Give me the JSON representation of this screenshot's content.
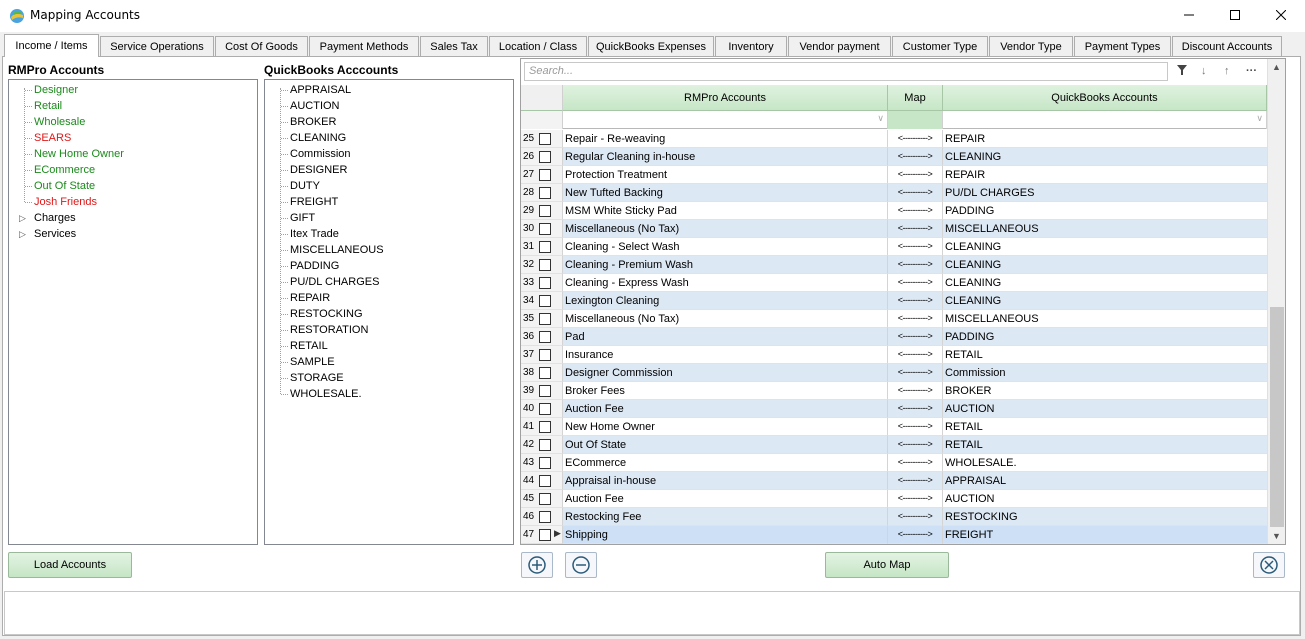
{
  "window": {
    "title": "Mapping Accounts"
  },
  "tabs": [
    "Income / Items",
    "Service Operations",
    "Cost Of Goods",
    "Payment Methods",
    "Sales Tax",
    "Location / Class",
    "QuickBooks Expenses",
    "Inventory",
    "Vendor payment",
    "Customer Type",
    "Vendor Type",
    "Payment Types",
    "Discount Accounts"
  ],
  "left": {
    "title": "RMPro Accounts",
    "items": [
      {
        "label": "Designer",
        "color": "green"
      },
      {
        "label": "Retail",
        "color": "green"
      },
      {
        "label": "Wholesale",
        "color": "green"
      },
      {
        "label": "SEARS",
        "color": "red"
      },
      {
        "label": "New Home Owner",
        "color": "green"
      },
      {
        "label": "ECommerce",
        "color": "green"
      },
      {
        "label": "Out Of State",
        "color": "green"
      },
      {
        "label": "Josh Friends",
        "color": "red"
      },
      {
        "label": "Charges",
        "color": "black",
        "expandable": true
      },
      {
        "label": "Services",
        "color": "black",
        "expandable": true
      }
    ],
    "load_button": "Load Accounts"
  },
  "middle": {
    "title": "QuickBooks Acccounts",
    "items": [
      "APPRAISAL",
      "AUCTION",
      "BROKER",
      "CLEANING",
      "Commission",
      "DESIGNER",
      "DUTY",
      "FREIGHT",
      "GIFT",
      "Itex Trade",
      "MISCELLANEOUS",
      "PADDING",
      "PU/DL CHARGES",
      "REPAIR",
      "RESTOCKING",
      "RESTORATION",
      "RETAIL",
      "SAMPLE",
      "STORAGE",
      "WHOLESALE."
    ]
  },
  "grid": {
    "search_placeholder": "Search...",
    "headers": {
      "rmpro": "RMPro Accounts",
      "map": "Map",
      "qb": "QuickBooks Accounts"
    },
    "map_symbol": "<---------->",
    "rows": [
      {
        "n": "25",
        "rm": "Repair - Re-weaving",
        "qb": "REPAIR"
      },
      {
        "n": "26",
        "rm": "Regular Cleaning in-house",
        "qb": "CLEANING"
      },
      {
        "n": "27",
        "rm": "Protection Treatment",
        "qb": "REPAIR"
      },
      {
        "n": "28",
        "rm": "New Tufted Backing",
        "qb": "PU/DL CHARGES"
      },
      {
        "n": "29",
        "rm": "MSM White Sticky Pad",
        "qb": "PADDING"
      },
      {
        "n": "30",
        "rm": "Miscellaneous (No Tax)",
        "qb": "MISCELLANEOUS"
      },
      {
        "n": "31",
        "rm": "Cleaning - Select Wash",
        "qb": "CLEANING"
      },
      {
        "n": "32",
        "rm": "Cleaning - Premium Wash",
        "qb": "CLEANING"
      },
      {
        "n": "33",
        "rm": "Cleaning - Express Wash",
        "qb": "CLEANING"
      },
      {
        "n": "34",
        "rm": "Lexington Cleaning",
        "qb": "CLEANING"
      },
      {
        "n": "35",
        "rm": "Miscellaneous (No Tax)",
        "qb": "MISCELLANEOUS"
      },
      {
        "n": "36",
        "rm": "Pad",
        "qb": "PADDING"
      },
      {
        "n": "37",
        "rm": "Insurance",
        "qb": "RETAIL"
      },
      {
        "n": "38",
        "rm": "Designer Commission",
        "qb": "Commission"
      },
      {
        "n": "39",
        "rm": "Broker Fees",
        "qb": "BROKER"
      },
      {
        "n": "40",
        "rm": "Auction Fee",
        "qb": "AUCTION"
      },
      {
        "n": "41",
        "rm": "New Home Owner",
        "qb": "RETAIL"
      },
      {
        "n": "42",
        "rm": "Out Of State",
        "qb": "RETAIL"
      },
      {
        "n": "43",
        "rm": "ECommerce",
        "qb": "WHOLESALE."
      },
      {
        "n": "44",
        "rm": "Appraisal in-house",
        "qb": "APPRAISAL"
      },
      {
        "n": "45",
        "rm": "Auction Fee",
        "qb": "AUCTION"
      },
      {
        "n": "46",
        "rm": "Restocking Fee",
        "qb": "RESTOCKING"
      },
      {
        "n": "47",
        "rm": "Shipping",
        "qb": "FREIGHT"
      }
    ],
    "auto_map_button": "Auto Map"
  },
  "colors": {
    "green_text": "#1b8a1b",
    "red_text": "#e01818",
    "header_green": "#c7e6c7",
    "row_alt": "#dde8f5"
  }
}
